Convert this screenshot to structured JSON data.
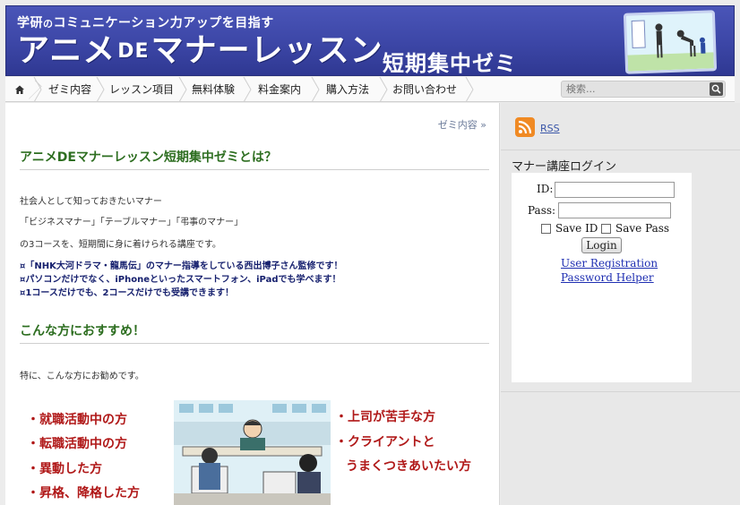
{
  "header": {
    "tagline_a": "学研",
    "tagline_b": "の",
    "tagline_c": "コミュニケーション力アップを目指す",
    "title_a": "アニメ",
    "title_de": "DE",
    "title_b": "マナーレッスン",
    "subtitle": "短期集中ゼミ"
  },
  "nav": {
    "items": [
      "ゼミ内容",
      "レッスン項目",
      "無料体験",
      "料金案内",
      "購入方法",
      "お問い合わせ"
    ],
    "search_placeholder": "検索..."
  },
  "main": {
    "breadcrumb": "ゼミ内容 »",
    "section1_title": "アニメDEマナーレッスン短期集中ゼミとは？",
    "p1": "社会人として知っておきたいマナー",
    "p2": "「ビジネスマナー」「テーブルマナー」「弔事のマナー」",
    "p3": "の3コースを、短期間に身に着けられる講座です。",
    "b1": "¤「NHK大河ドラマ・龍馬伝」のマナー指導をしている西出博子さん監修です！",
    "b2": "¤パソコンだけでなく、iPhoneといったスマートフォン、iPadでも学べます！",
    "b3": "¤1コースだけでも、2コースだけでも受講できます！",
    "section2_title": "こんな方におすすめ！",
    "p4": "特に、こんな方にお勧めです。",
    "left_list": [
      "・就職活動中の方",
      "・転職活動中の方",
      "・異動した方",
      "・昇格、降格した方"
    ],
    "right_list": [
      "・上司が苦手な方",
      "・クライアントと",
      "うまくつきあいたい方"
    ]
  },
  "sidebar": {
    "rss": "RSS",
    "login_title": "マナー講座ログイン",
    "id_label": "ID:",
    "pass_label": "Pass:",
    "save_id": "Save ID",
    "save_pass": "Save Pass",
    "login_button": "Login",
    "user_registration": "User Registration",
    "password_helper": "Password Helper"
  }
}
